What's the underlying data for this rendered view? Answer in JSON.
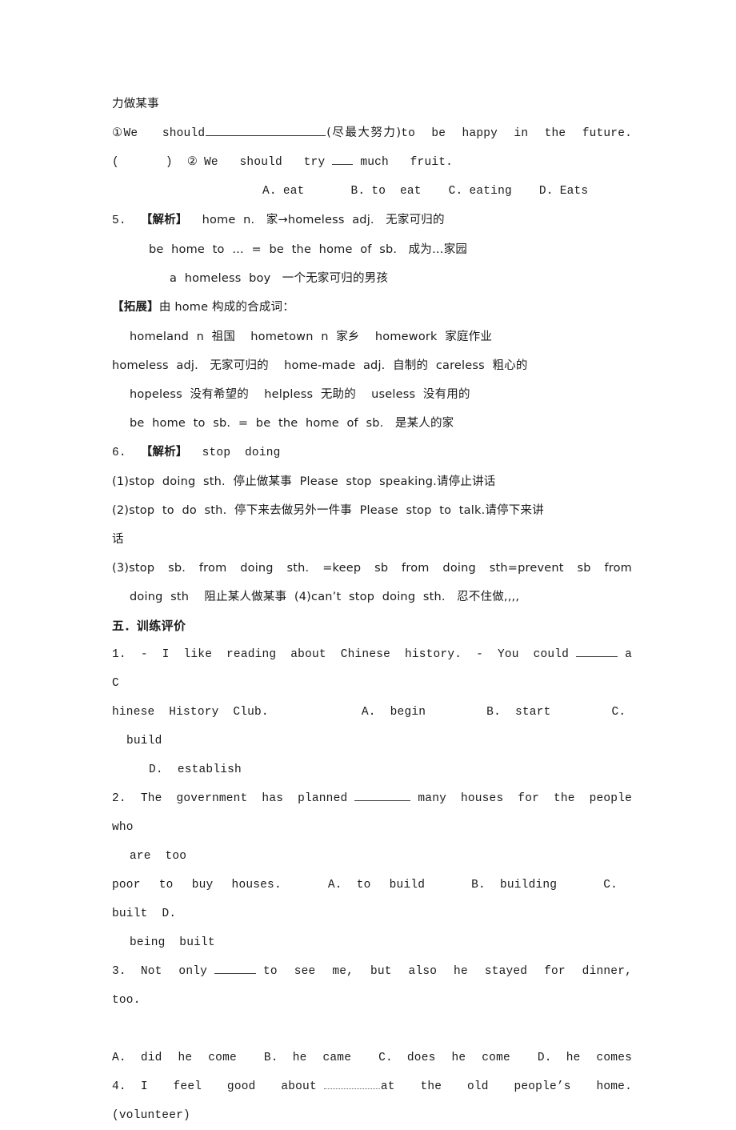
{
  "document": {
    "continuation_line": "力做某事",
    "items": [
      {
        "id": "item-1",
        "num": "①We",
        "text_before": "①We   should",
        "paren": "(尽最大努力)",
        "text_after": "to  be  happy  in  the  future."
      }
    ],
    "q_marker_line": {
      "paren_open": "(",
      "paren_close": ")",
      "circle_num": "②",
      "stem": "We   should   try",
      "tail": "much   fruit."
    },
    "options_fruit": [
      {
        "label": "A.",
        "text": "eat"
      },
      {
        "label": "B.",
        "text": "to  eat"
      },
      {
        "label": "C.",
        "text": "eating"
      },
      {
        "label": "D.",
        "text": "Eats"
      }
    ],
    "note5": {
      "num": "5.",
      "tag": "【解析】",
      "head": "home  n.   家→homeless  adj.   无家可归的",
      "line2": "be  home  to  …  =  be  the  home  of  sb.   成为…家园",
      "line3": "a  homeless  boy   一个无家可归的男孩"
    },
    "expansion": {
      "tag": "【拓展】",
      "title": "由 home 构成的合成词：",
      "lines": [
        "homeland  n  祖国    hometown  n  家乡    homework  家庭作业",
        "homeless  adj.   无家可归的    home-made  adj.  自制的  careless  粗心的",
        "hopeless  没有希望的    helpless  无助的    useless  没有用的",
        "be  home  to  sb.  =  be  the  home  of  sb.   是某人的家"
      ]
    },
    "note6": {
      "num": "6.",
      "tag": "【解析】",
      "head": "stop  doing",
      "lines": [
        "(1)stop  doing  sth.  停止做某事  Please  stop  speaking.请停止讲话",
        "(2)stop  to  do  sth.  停下来去做另外一件事  Please  stop  to  talk.请停下来讲",
        "话",
        "(3)stop  sb.  from  doing  sth.  =keep  sb  from  doing  sth=prevent  sb  from",
        "doing  sth    阻止某人做某事  (4)can’t  stop  doing  sth.   忍不住做,,,,"
      ]
    },
    "section_heading": "五．训练评价",
    "exercises": [
      {
        "num": "1.",
        "stem_a": "-  I  like  reading  about  Chinese  history.  -  You  could",
        "stem_b": "a  C",
        "stem_c": "hinese  History  Club.",
        "options": [
          {
            "label": "A.",
            "text": "begin"
          },
          {
            "label": "B.",
            "text": "start"
          },
          {
            "label": "C.",
            "text": "build"
          },
          {
            "label": "D.",
            "text": "establish"
          }
        ]
      },
      {
        "num": "2.",
        "stem_a": "The  government  has  planned",
        "stem_b": "many  houses  for  the  people  who",
        "stem_c": "are  too",
        "stem_d": "poor  to  buy  houses.",
        "options": [
          {
            "label": "A.",
            "text": "to  build"
          },
          {
            "label": "B.",
            "text": "building"
          },
          {
            "label": "C.",
            "text": "built"
          },
          {
            "label": "D.",
            "text": "being  built"
          }
        ]
      },
      {
        "num": "3.",
        "stem_a": "Not  only",
        "stem_b": "to  see  me,  but  also  he  stayed  for  dinner,  too.",
        "options": [
          {
            "label": "A.",
            "text": "did  he  come"
          },
          {
            "label": "B.",
            "text": "he  came"
          },
          {
            "label": "C.",
            "text": "does  he  come"
          },
          {
            "label": "D.",
            "text": "he  comes"
          }
        ]
      },
      {
        "num": "4.",
        "stem_a": "I  feel  good  about",
        "stem_b": "at  the  old  people’s  home.  (volunteer)"
      }
    ]
  }
}
